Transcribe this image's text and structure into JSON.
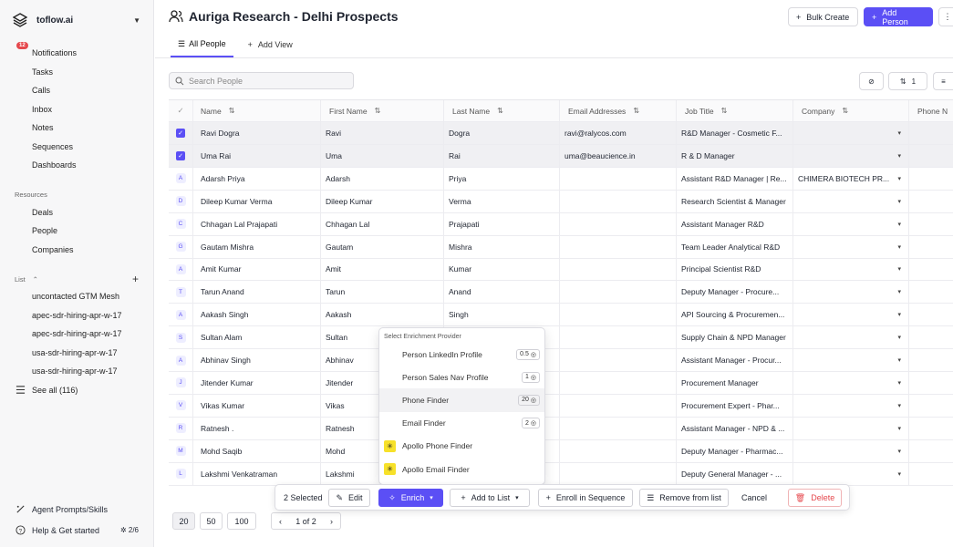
{
  "workspace": {
    "name": "toflow.ai"
  },
  "nav": {
    "notifications_badge": "12",
    "items": [
      {
        "label": "Notifications",
        "icon": "bell-icon"
      },
      {
        "label": "Tasks",
        "icon": "checkbox-icon"
      },
      {
        "label": "Calls",
        "icon": "phone-icon"
      },
      {
        "label": "Inbox",
        "icon": "inbox-icon"
      },
      {
        "label": "Notes",
        "icon": "note-icon"
      },
      {
        "label": "Sequences",
        "icon": "sequence-icon"
      },
      {
        "label": "Dashboards",
        "icon": "dashboard-icon"
      }
    ]
  },
  "resources": {
    "heading": "Resources",
    "items": [
      {
        "label": "Deals"
      },
      {
        "label": "People"
      },
      {
        "label": "Companies"
      }
    ]
  },
  "lists": {
    "heading": "List",
    "items": [
      {
        "label": "uncontacted GTM Mesh"
      },
      {
        "label": "apec-sdr-hiring-apr-w-17"
      },
      {
        "label": "apec-sdr-hiring-apr-w-17"
      },
      {
        "label": "usa-sdr-hiring-apr-w-17"
      },
      {
        "label": "usa-sdr-hiring-apr-w-17"
      }
    ],
    "see_all": "See all (116)"
  },
  "footer": {
    "agent": "Agent Prompts/Skills",
    "help": "Help & Get started",
    "progress": "2/6"
  },
  "header": {
    "title": "Auriga Research - Delhi Prospects",
    "bulk_create": "Bulk Create",
    "add_person": "Add Person"
  },
  "tabs": {
    "all_people": "All People",
    "add_view": "Add View"
  },
  "search": {
    "placeholder": "Search People"
  },
  "toolbar": {
    "sort_count": "1"
  },
  "table": {
    "columns": [
      "Name",
      "First Name",
      "Last Name",
      "Email Addresses",
      "Job Title",
      "Company",
      "Phone N"
    ],
    "rows": [
      {
        "initial": "",
        "selected": true,
        "name": "Ravi Dogra",
        "first": "Ravi",
        "last": "Dogra",
        "email": "ravi@ralycos.com",
        "job": "R&D Manager - Cosmetic F...",
        "company": ""
      },
      {
        "initial": "",
        "selected": true,
        "name": "Uma Rai",
        "first": "Uma",
        "last": "Rai",
        "email": "uma@beaucience.in",
        "job": "R & D Manager",
        "company": ""
      },
      {
        "initial": "A",
        "selected": false,
        "name": "Adarsh Priya",
        "first": "Adarsh",
        "last": "Priya",
        "email": "",
        "job": "Assistant R&D Manager | Re...",
        "company": "CHIMERA BIOTECH PR..."
      },
      {
        "initial": "D",
        "selected": false,
        "name": "Dileep Kumar Verma",
        "first": "Dileep Kumar",
        "last": "Verma",
        "email": "",
        "job": "Research Scientist & Manager",
        "company": ""
      },
      {
        "initial": "C",
        "selected": false,
        "name": "Chhagan Lal Prajapati",
        "first": "Chhagan Lal",
        "last": "Prajapati",
        "email": "",
        "job": "Assistant Manager R&D",
        "company": ""
      },
      {
        "initial": "G",
        "selected": false,
        "name": "Gautam Mishra",
        "first": "Gautam",
        "last": "Mishra",
        "email": "",
        "job": "Team Leader Analytical R&D",
        "company": ""
      },
      {
        "initial": "A",
        "selected": false,
        "name": "Amit Kumar",
        "first": "Amit",
        "last": "Kumar",
        "email": "",
        "job": "Principal Scientist R&D",
        "company": ""
      },
      {
        "initial": "T",
        "selected": false,
        "name": "Tarun Anand",
        "first": "Tarun",
        "last": "Anand",
        "email": "",
        "job": "Deputy Manager - Procure...",
        "company": ""
      },
      {
        "initial": "A",
        "selected": false,
        "name": "Aakash Singh",
        "first": "Aakash",
        "last": "Singh",
        "email": "",
        "job": "API Sourcing & Procuremen...",
        "company": ""
      },
      {
        "initial": "S",
        "selected": false,
        "name": "Sultan Alam",
        "first": "Sultan",
        "last": "",
        "email": "",
        "job": "Supply Chain & NPD Manager",
        "company": ""
      },
      {
        "initial": "A",
        "selected": false,
        "name": "Abhinav Singh",
        "first": "Abhinav",
        "last": "",
        "email": "",
        "job": "Assistant Manager - Procur...",
        "company": ""
      },
      {
        "initial": "J",
        "selected": false,
        "name": "Jitender Kumar",
        "first": "Jitender",
        "last": "",
        "email": "",
        "job": "Procurement Manager",
        "company": ""
      },
      {
        "initial": "V",
        "selected": false,
        "name": "Vikas Kumar",
        "first": "Vikas",
        "last": "",
        "email": "",
        "job": "Procurement Expert - Phar...",
        "company": ""
      },
      {
        "initial": "R",
        "selected": false,
        "name": "Ratnesh .",
        "first": "Ratnesh",
        "last": "",
        "email": "",
        "job": "Assistant Manager - NPD & ...",
        "company": ""
      },
      {
        "initial": "M",
        "selected": false,
        "name": "Mohd Saqib",
        "first": "Mohd",
        "last": "",
        "email": "",
        "job": "Deputy Manager - Pharmac...",
        "company": ""
      },
      {
        "initial": "L",
        "selected": false,
        "name": "Lakshmi Venkatraman",
        "first": "Lakshmi",
        "last": "",
        "email": "",
        "job": "Deputy General Manager - ...",
        "company": ""
      }
    ]
  },
  "enrich_popup": {
    "title": "Select Enrichment Provider",
    "items": [
      {
        "label": "Person LinkedIn Profile",
        "credit": "0.5",
        "icon": "toflow-icon"
      },
      {
        "label": "Person Sales Nav Profile",
        "credit": "1",
        "icon": "toflow-icon"
      },
      {
        "label": "Phone Finder",
        "credit": "20",
        "icon": "toflow-icon"
      },
      {
        "label": "Email Finder",
        "credit": "2",
        "icon": "toflow-icon"
      },
      {
        "label": "Apollo Phone Finder",
        "credit": "",
        "icon": "apollo-icon"
      },
      {
        "label": "Apollo Email Finder",
        "credit": "",
        "icon": "apollo-icon"
      }
    ]
  },
  "action_bar": {
    "selected": "2 Selected",
    "edit": "Edit",
    "enrich": "Enrich",
    "add_to_list": "Add to List",
    "enroll": "Enroll in Sequence",
    "remove": "Remove from list",
    "cancel": "Cancel",
    "delete": "Delete"
  },
  "pagination": {
    "sizes": [
      "20",
      "50",
      "100"
    ],
    "page": "1 of 2"
  }
}
